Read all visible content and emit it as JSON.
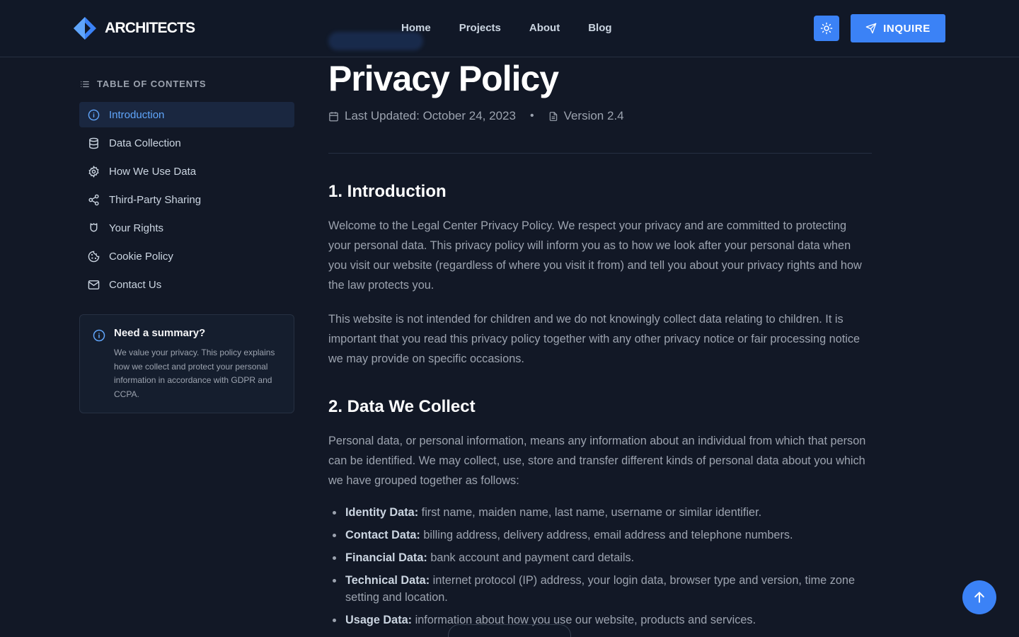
{
  "brand": {
    "name": "ARCHITECTS"
  },
  "nav": {
    "items": [
      "Home",
      "Projects",
      "About",
      "Blog"
    ]
  },
  "header": {
    "inquire_label": "INQUIRE"
  },
  "toc": {
    "heading": "TABLE OF CONTENTS",
    "items": [
      {
        "label": "Introduction",
        "icon": "info-icon",
        "active": true
      },
      {
        "label": "Data Collection",
        "icon": "database-icon",
        "active": false
      },
      {
        "label": "How We Use Data",
        "icon": "gear-icon",
        "active": false
      },
      {
        "label": "Third-Party Sharing",
        "icon": "share-icon",
        "active": false
      },
      {
        "label": "Your Rights",
        "icon": "shield-icon",
        "active": false
      },
      {
        "label": "Cookie Policy",
        "icon": "cookie-icon",
        "active": false
      },
      {
        "label": "Contact Us",
        "icon": "mail-icon",
        "active": false
      }
    ]
  },
  "summary": {
    "title": "Need a summary?",
    "text": "We value your privacy. This policy explains how we collect and protect your personal information in accordance with GDPR and CCPA."
  },
  "page": {
    "title": "Privacy Policy",
    "last_updated": "Last Updated: October 24, 2023",
    "version": "Version 2.4"
  },
  "sections": {
    "intro": {
      "heading": "1. Introduction",
      "p1": "Welcome to the Legal Center Privacy Policy. We respect your privacy and are committed to protecting your personal data. This privacy policy will inform you as to how we look after your personal data when you visit our website (regardless of where you visit it from) and tell you about your privacy rights and how the law protects you.",
      "p2": "This website is not intended for children and we do not knowingly collect data relating to children. It is important that you read this privacy policy together with any other privacy notice or fair processing notice we may provide on specific occasions."
    },
    "collect": {
      "heading": "2. Data We Collect",
      "p1": "Personal data, or personal information, means any information about an individual from which that person can be identified. We may collect, use, store and transfer different kinds of personal data about you which we have grouped together as follows:",
      "bullets": [
        {
          "term": "Identity Data:",
          "text": " first name, maiden name, last name, username or similar identifier."
        },
        {
          "term": "Contact Data:",
          "text": " billing address, delivery address, email address and telephone numbers."
        },
        {
          "term": "Financial Data:",
          "text": " bank account and payment card details."
        },
        {
          "term": "Technical Data:",
          "text": " internet protocol (IP) address, your login data, browser type and version, time zone setting and location."
        },
        {
          "term": "Usage Data:",
          "text": " information about how you use our website, products and services."
        }
      ]
    }
  },
  "colors": {
    "accent": "#3b82f6",
    "background": "#121826",
    "header": "#111827"
  }
}
